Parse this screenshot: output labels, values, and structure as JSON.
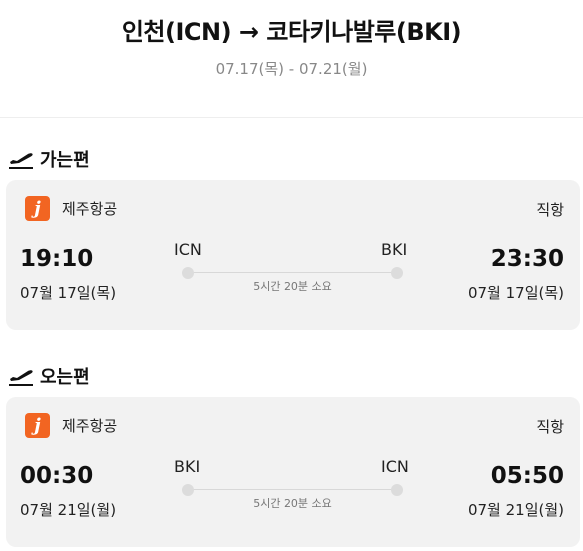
{
  "header": {
    "title": "인천(ICN) → 코타키나발루(BKI)",
    "dates": "07.17(목) - 07.21(월)"
  },
  "outbound": {
    "section_title": "가는편",
    "section_icon": "plane-departure-icon",
    "airline_logo_letter": "j",
    "airline_name": "제주항공",
    "flight_type": "직항",
    "dep_time": "19:10",
    "dep_date": "07월 17일(목)",
    "dep_code": "ICN",
    "arr_time": "23:30",
    "arr_date": "07월 17일(목)",
    "arr_code": "BKI",
    "duration": "5시간 20분 소요"
  },
  "inbound": {
    "section_title": "오는편",
    "section_icon": "plane-departure-icon",
    "airline_logo_letter": "j",
    "airline_name": "제주항공",
    "flight_type": "직항",
    "dep_time": "00:30",
    "dep_date": "07월 21일(월)",
    "dep_code": "BKI",
    "arr_time": "05:50",
    "arr_date": "07월 21일(월)",
    "arr_code": "ICN",
    "duration": "5시간 20분 소요"
  },
  "colors": {
    "airline_brand": "#f26522",
    "card_background": "#f2f2f2",
    "muted_text": "#888888"
  }
}
